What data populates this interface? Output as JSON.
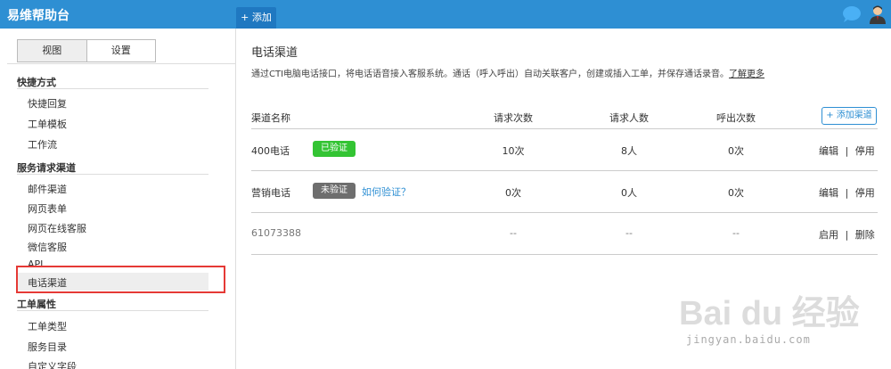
{
  "app": {
    "title": "易维帮助台",
    "add_label": "+ 添加"
  },
  "sidebar": {
    "tabs": [
      "视图",
      "设置"
    ],
    "sections": [
      {
        "title": "快捷方式",
        "items": [
          "快捷回复",
          "工单模板",
          "工作流"
        ]
      },
      {
        "title": "服务请求渠道",
        "items": [
          "邮件渠道",
          "网页表单",
          "网页在线客服",
          "微信客服",
          "API",
          "电话渠道"
        ]
      },
      {
        "title": "工单属性",
        "items": [
          "工单类型",
          "服务目录",
          "自定义字段"
        ]
      }
    ],
    "selected_item": "电话渠道"
  },
  "main": {
    "title": "电话渠道",
    "description": "通过CTI电脑电话接口，将电话语音接入客服系统。通话（呼入呼出）自动关联客户，创建或插入工单，并保存通话录音。",
    "learn_more": "了解更多",
    "add_channel": "+ 添加渠道",
    "columns": [
      "渠道名称",
      "请求次数",
      "请求人数",
      "呼出次数"
    ],
    "rows": [
      {
        "name": "400电话",
        "badge": "已验证",
        "help": "",
        "requests": "10次",
        "people": "8人",
        "outbound": "0次",
        "op1": "编辑",
        "sep": "|",
        "op2": "停用"
      },
      {
        "name": "营销电话",
        "badge": "未验证",
        "help": "如何验证？",
        "requests": "0次",
        "people": "0人",
        "outbound": "0次",
        "op1": "编辑",
        "sep": "|",
        "op2": "停用"
      },
      {
        "name": "61073388",
        "badge": "",
        "help": "",
        "requests": "--",
        "people": "--",
        "outbound": "--",
        "op1": "启用",
        "sep": "|",
        "op2": "删除"
      }
    ]
  },
  "watermark": {
    "brand": "Bai du 经验",
    "url": "jingyan.baidu.com"
  },
  "colors": {
    "topbar": "#2e8fd3",
    "verified": "#33c433",
    "unverified": "#6e6e6e",
    "highlight": "#e53935",
    "link": "#2e8fd3"
  },
  "icons": [
    "chat-bubble-icon",
    "user-avatar-icon",
    "paw-watermark-icon"
  ]
}
